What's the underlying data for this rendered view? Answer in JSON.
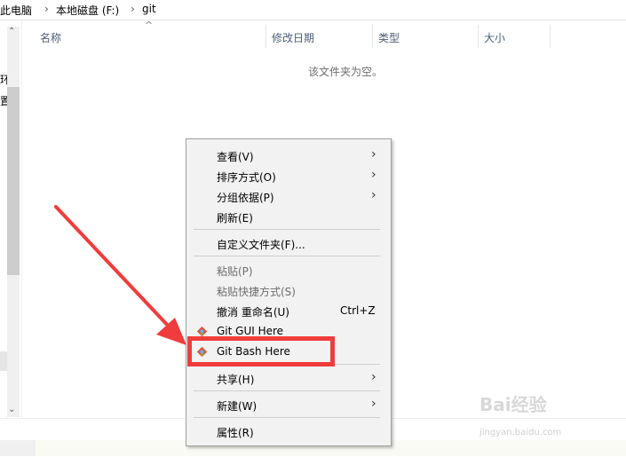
{
  "breadcrumb": {
    "items": [
      "此电脑",
      "本地磁盘 (F:)",
      "git"
    ],
    "separator": "›"
  },
  "nav": {
    "fragments": [
      "环",
      "置"
    ]
  },
  "columns": {
    "name": "名称",
    "modified": "修改日期",
    "type": "类型",
    "size": "大小"
  },
  "empty_message": "该文件夹为空。",
  "context_menu": {
    "items": [
      {
        "label": "查看(V)",
        "submenu": true
      },
      {
        "label": "排序方式(O)",
        "submenu": true
      },
      {
        "label": "分组依据(P)",
        "submenu": true
      },
      {
        "label": "刷新(E)"
      },
      {
        "label": "自定义文件夹(F)..."
      },
      {
        "label": "粘贴(P)",
        "disabled": true
      },
      {
        "label": "粘贴快捷方式(S)",
        "disabled": true
      },
      {
        "label": "撤消 重命名(U)",
        "shortcut": "Ctrl+Z"
      },
      {
        "label": "Git GUI Here",
        "icon": "git-icon"
      },
      {
        "label": "Git Bash Here",
        "icon": "git-icon",
        "highlighted": true
      },
      {
        "label": "共享(H)",
        "submenu": true
      },
      {
        "label": "新建(W)",
        "submenu": true
      },
      {
        "label": "属性(R)"
      }
    ]
  },
  "watermark": {
    "text": "Bai经验",
    "sub": "jingyan.baidu.com"
  },
  "colors": {
    "highlight_border": "#f03c3c",
    "arrow": "#f03c3c",
    "menu_bg": "#f2f2f2"
  }
}
